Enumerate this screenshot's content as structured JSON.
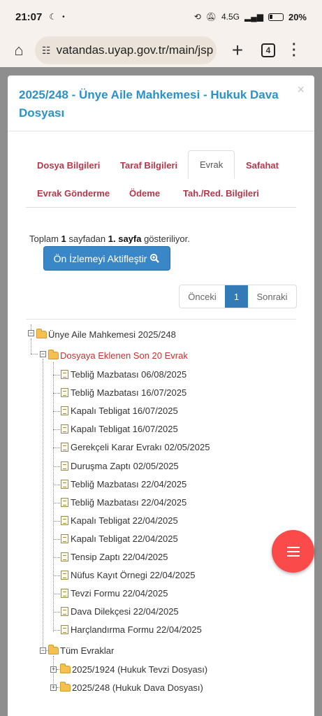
{
  "status_bar": {
    "time": "21:07",
    "battery": "20%",
    "network": "4.5G"
  },
  "browser": {
    "url": "vatandas.uyap.gov.tr/main/jsp",
    "tab_count": "4"
  },
  "modal": {
    "title": "2025/248 - Ünye Aile Mahkemesi - Hukuk Dava Dosyası",
    "close": "×"
  },
  "tabs": [
    "Dosya Bilgileri",
    "Taraf Bilgileri",
    "Evrak",
    "Safahat",
    "Evrak Gönderme",
    "Ödeme",
    "Tah./Red. Bilgileri"
  ],
  "active_tab": "Evrak",
  "summary": {
    "pre": "Toplam ",
    "pages": "1",
    "mid": " sayfadan ",
    "page": "1. sayfa",
    "post": " gösteriliyor."
  },
  "preview_button": "Ön İzlemeyi Aktifleştir",
  "pager": {
    "prev": "Önceki",
    "current": "1",
    "next": "Sonraki"
  },
  "tree": {
    "root": "Ünye Aile Mahkemesi 2025/248",
    "recent_folder": "Dosyaya Eklenen Son 20 Evrak",
    "documents": [
      "Tebliğ Mazbatası 06/08/2025",
      "Tebliğ Mazbatası 16/07/2025",
      "Kapalı Tebligat 16/07/2025",
      "Kapalı Tebligat 16/07/2025",
      "Gerekçeli Karar Evrakı 02/05/2025",
      "Duruşma Zaptı 02/05/2025",
      "Tebliğ Mazbatası 22/04/2025",
      "Tebliğ Mazbatası 22/04/2025",
      "Kapalı Tebligat 22/04/2025",
      "Kapalı Tebligat 22/04/2025",
      "Tensip Zaptı 22/04/2025",
      "Nüfus Kayıt Örnegi 22/04/2025",
      "Tevzi Formu 22/04/2025",
      "Dava Dilekçesi 22/04/2025",
      "Harçlandırma Formu 22/04/2025"
    ],
    "all_folder": "Tüm Evraklar",
    "sub_folders": [
      "2025/1924 (Hukuk Tevzi Dosyası)",
      "2025/248 (Hukuk Dava Dosyası)"
    ]
  },
  "icons": {
    "home": "home-icon",
    "tune": "site-info-icon",
    "plus": "new-tab-icon",
    "menu": "overflow-menu-icon",
    "search": "zoom-icon",
    "fab": "menu-icon"
  },
  "colors": {
    "title": "#2a92c8",
    "tab": "#b5384a",
    "primary_button": "#3a87c8",
    "fab": "#fb4a4a",
    "red_node": "#c9312b"
  }
}
